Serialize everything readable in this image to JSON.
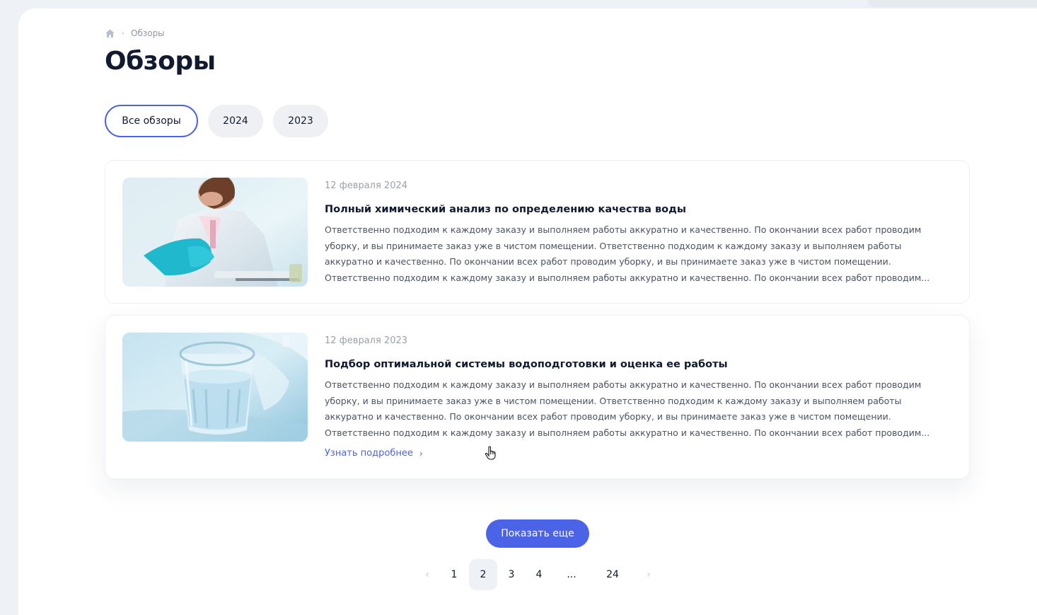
{
  "breadcrumb": {
    "current": "Обзоры"
  },
  "page": {
    "title": "Обзоры"
  },
  "filters": [
    {
      "label": "Все обзоры",
      "active": true
    },
    {
      "label": "2024",
      "active": false
    },
    {
      "label": "2023",
      "active": false
    }
  ],
  "reviews": [
    {
      "date": "12 февраля 2024",
      "title": "Полный химический анализ по определению качества воды",
      "text": [
        "Ответственно подходим к каждому заказу и выполняем работы аккуратно и качественно. По окончании всех работ проводим",
        "уборку, и вы принимаете заказ уже в чистом помещении. Ответственно подходим к каждому заказу и выполняем работы",
        "аккуратно и качественно. По окончании всех работ проводим уборку, и вы принимаете заказ уже в чистом помещении.",
        "Ответственно подходим к каждому заказу и выполняем работы аккуратно и качественно. По окончании всех работ проводим..."
      ]
    },
    {
      "date": "12 февраля 2023",
      "title": "Подбор оптимальной системы водоподготовки и оценка ее работы",
      "text": [
        "Ответственно подходим к каждому заказу и выполняем работы аккуратно и качественно. По окончании всех работ проводим",
        "уборку, и вы принимаете заказ уже в чистом помещении. Ответственно подходим к каждому заказу и выполняем работы",
        "аккуратно и качественно. По окончании всех работ проводим уборку, и вы принимаете заказ уже в чистом помещении.",
        "Ответственно подходим к каждому заказу и выполняем работы аккуратно и качественно. По окончании всех работ проводим..."
      ],
      "link": "Узнать подробнее",
      "link_arrow": "›"
    }
  ],
  "show_more": "Показать еще",
  "pagination": {
    "prev": "‹",
    "next": "›",
    "pages": [
      "1",
      "2",
      "3",
      "4",
      "...",
      "24"
    ],
    "current": "2"
  },
  "colors": {
    "accent": "#4a63e7",
    "title": "#111a2e",
    "muted": "#9aa1ad"
  },
  "icons": {
    "home": "home-icon",
    "breadcrumb_separator": "›",
    "cursor": "hand-pointer-icon"
  }
}
